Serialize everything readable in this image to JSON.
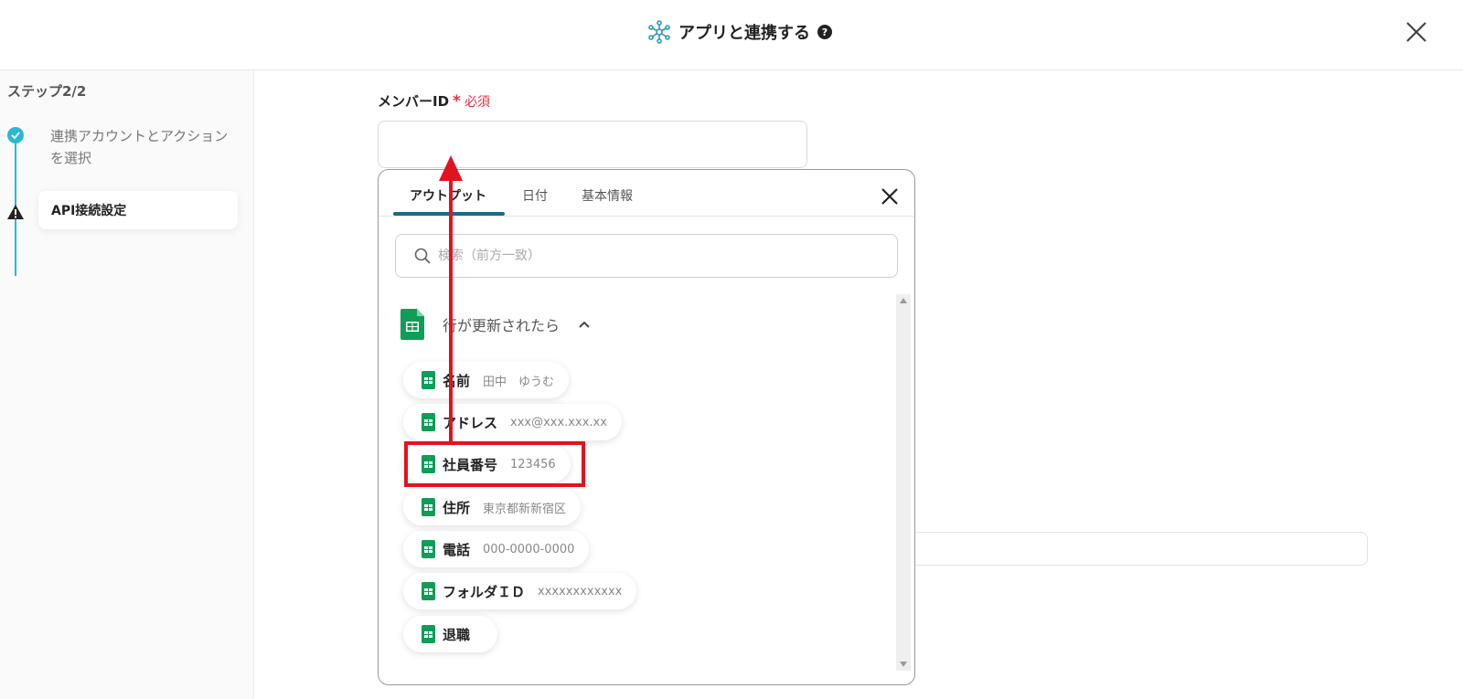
{
  "header": {
    "title": "アプリと連携する",
    "help": "?"
  },
  "sidebar": {
    "step_counter": "ステップ2/2",
    "step1": "連携アカウントとアクションを選択",
    "step2": "API接続設定"
  },
  "field": {
    "label": "メンバーID",
    "required_mark": "*",
    "required_text": "必須",
    "value": ""
  },
  "popover": {
    "tabs": [
      "アウトプット",
      "日付",
      "基本情報"
    ],
    "search_placeholder": "検索（前方一致）",
    "group_title": "行が更新されたら",
    "items": [
      {
        "key": "名前",
        "value": "田中　ゆうむ"
      },
      {
        "key": "アドレス",
        "value": "xxx@xxx.xxx.xx"
      },
      {
        "key": "社員番号",
        "value": "123456"
      },
      {
        "key": "住所",
        "value": "東京都新新宿区"
      },
      {
        "key": "電話",
        "value": "000-0000-0000"
      },
      {
        "key": "フォルダＩＤ",
        "value": "xxxxxxxxxxxx"
      },
      {
        "key": "退職",
        "value": ""
      }
    ]
  },
  "colors": {
    "accent": "#2bb8d1",
    "tab_underline": "#1d6a86",
    "sheet_green": "#0f9d58",
    "highlight_red": "#e0141e"
  }
}
